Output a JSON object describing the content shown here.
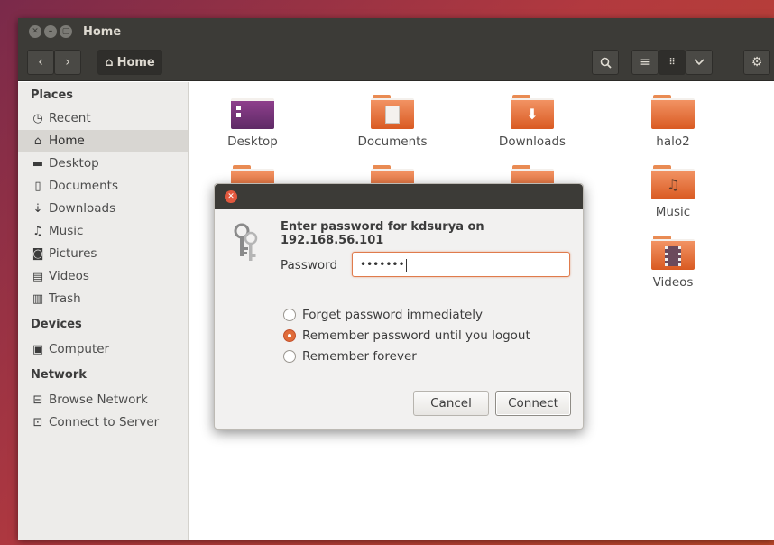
{
  "window": {
    "title": "Home",
    "controls": [
      "close-icon",
      "minimize-icon",
      "maximize-icon"
    ]
  },
  "toolbar": {
    "back_icon": "chevron-left-icon",
    "forward_icon": "chevron-right-icon",
    "breadcrumb_label": "Home",
    "breadcrumb_icon": "home-icon",
    "search_icon": "search-icon",
    "list_view_icon": "list-icon",
    "grid_view_icon": "grid-icon",
    "view_options_icon": "chevron-down-icon",
    "settings_icon": "gear-icon"
  },
  "sidebar": {
    "places_heading": "Places",
    "places": [
      {
        "label": "Recent",
        "icon": "clock-icon"
      },
      {
        "label": "Home",
        "icon": "home-icon"
      },
      {
        "label": "Desktop",
        "icon": "folder-icon"
      },
      {
        "label": "Documents",
        "icon": "document-icon"
      },
      {
        "label": "Downloads",
        "icon": "download-icon"
      },
      {
        "label": "Music",
        "icon": "music-icon"
      },
      {
        "label": "Pictures",
        "icon": "camera-icon"
      },
      {
        "label": "Videos",
        "icon": "film-icon"
      },
      {
        "label": "Trash",
        "icon": "trash-icon"
      }
    ],
    "devices_heading": "Devices",
    "devices": [
      {
        "label": "Computer",
        "icon": "drive-icon"
      }
    ],
    "network_heading": "Network",
    "network": [
      {
        "label": "Browse Network",
        "icon": "network-icon"
      },
      {
        "label": "Connect to Server",
        "icon": "server-icon"
      }
    ]
  },
  "files": [
    {
      "label": "Desktop",
      "icon": "desktop-folder-icon"
    },
    {
      "label": "Documents",
      "icon": "documents-folder-icon"
    },
    {
      "label": "Downloads",
      "icon": "downloads-folder-icon"
    },
    {
      "label": "halo2",
      "icon": "folder-icon"
    },
    {
      "label": "Music",
      "icon": "music-folder-icon"
    },
    {
      "label": "Videos",
      "icon": "videos-folder-icon"
    }
  ],
  "dialog": {
    "prompt": "Enter password for kdsurya on 192.168.56.101",
    "password_label": "Password",
    "password_value": "•••••••",
    "options": [
      {
        "label": "Forget password immediately",
        "selected": false
      },
      {
        "label": "Remember password until you logout",
        "selected": true
      },
      {
        "label": "Remember forever",
        "selected": false
      }
    ],
    "cancel_label": "Cancel",
    "connect_label": "Connect",
    "icon": "keys-icon"
  },
  "colors": {
    "accent": "#e06c3a",
    "titlebar": "#3c3b37",
    "sidebar": "#edecea",
    "folder": "#e8743b"
  }
}
